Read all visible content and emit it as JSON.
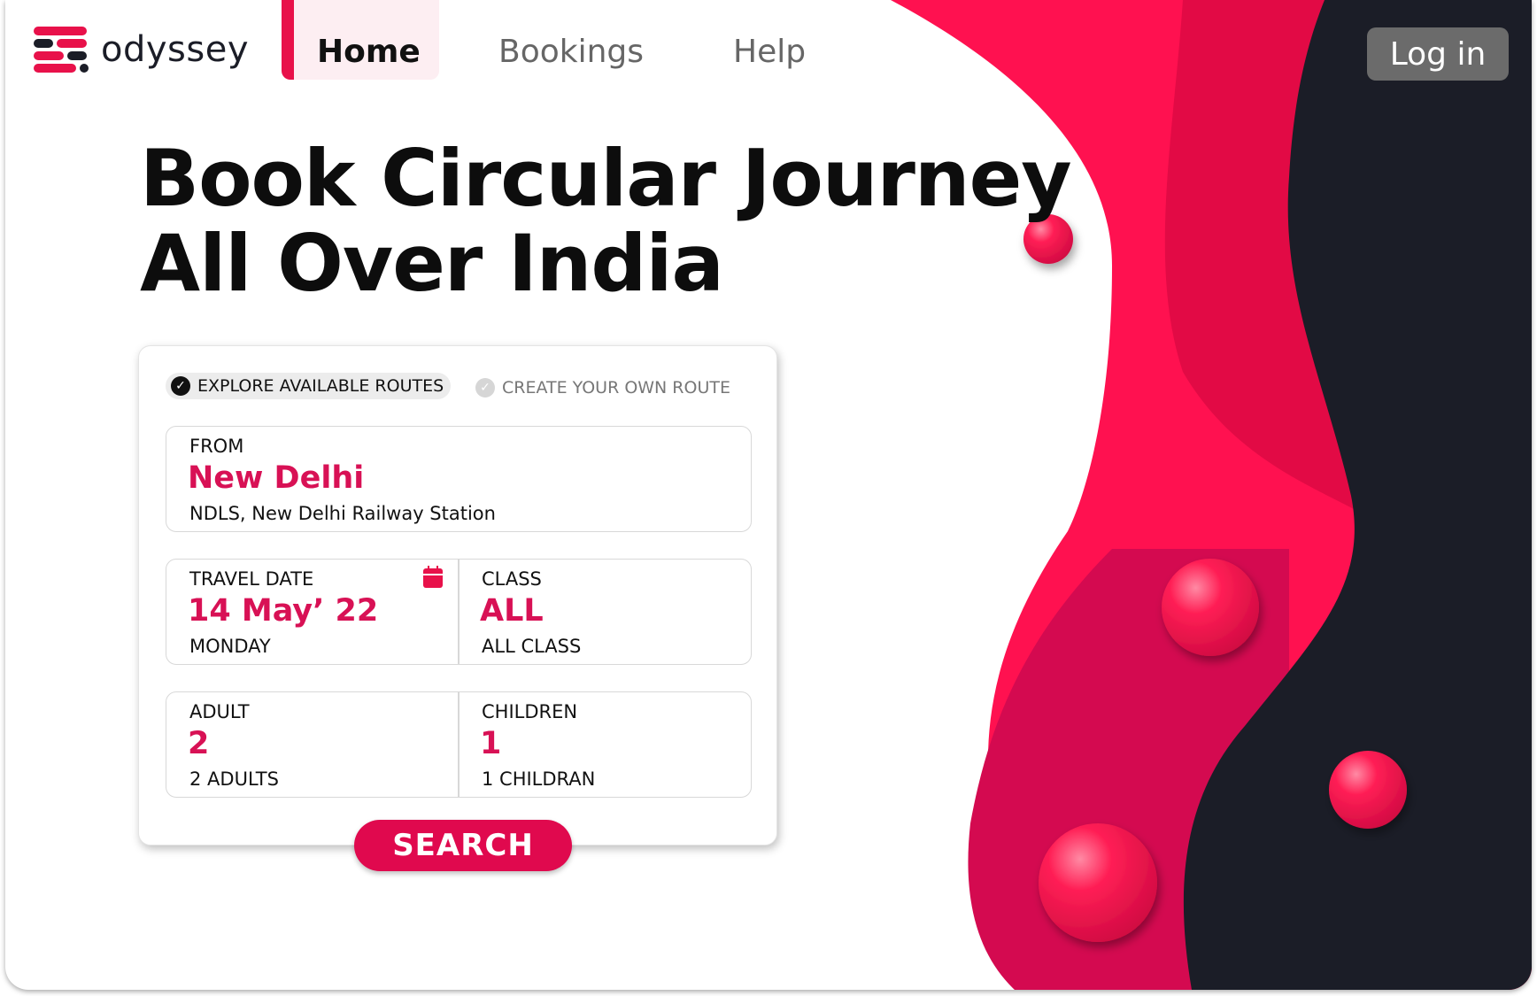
{
  "brand": {
    "name": "odyssey",
    "accent": "#e8114a",
    "dark": "#1b1d27"
  },
  "nav": {
    "home": "Home",
    "bookings": "Bookings",
    "help": "Help"
  },
  "login_label": "Log in",
  "hero": {
    "line1": "Book Circular Journey",
    "line2": "All Over India"
  },
  "route_tabs": {
    "explore": "EXPLORE AVAILABLE ROUTES",
    "create": "CREATE YOUR OWN ROUTE",
    "selected": "explore"
  },
  "from": {
    "label": "FROM",
    "value": "New Delhi",
    "sub": "NDLS, New Delhi Railway Station"
  },
  "travel_date": {
    "label": "TRAVEL DATE",
    "value": "14 May’ 22",
    "sub": "MONDAY",
    "icon": "calendar-icon"
  },
  "class": {
    "label": "CLASS",
    "value": "ALL",
    "sub": "ALL CLASS"
  },
  "adult": {
    "label": "ADULT",
    "value": "2",
    "sub": "2 ADULTS"
  },
  "children": {
    "label": "CHILDREN",
    "value": "1",
    "sub": "1 CHILDRAN"
  },
  "search_label": "SEARCH"
}
